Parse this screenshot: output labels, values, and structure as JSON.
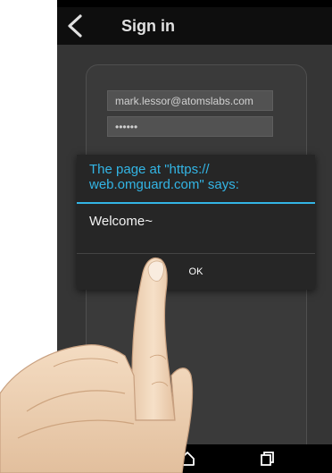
{
  "app_bar": {
    "title": "Sign in",
    "back_icon": "chevron-left-icon"
  },
  "form": {
    "email_value": "mark.lessor@atomslabs.com",
    "password_value": "••••••"
  },
  "dialog": {
    "title": "The page at \"https://\nweb.omguard.com\" says:",
    "message": "Welcome~",
    "ok_label": "OK"
  },
  "nav_bar": {
    "home_icon": "home-icon",
    "recents_icon": "recents-icon"
  },
  "colors": {
    "accent": "#33b5e5",
    "dialog_bg": "#262626",
    "screen_bg": "#3d3d3d",
    "app_bar_bg": "#111111",
    "nav_bg": "#000000"
  }
}
